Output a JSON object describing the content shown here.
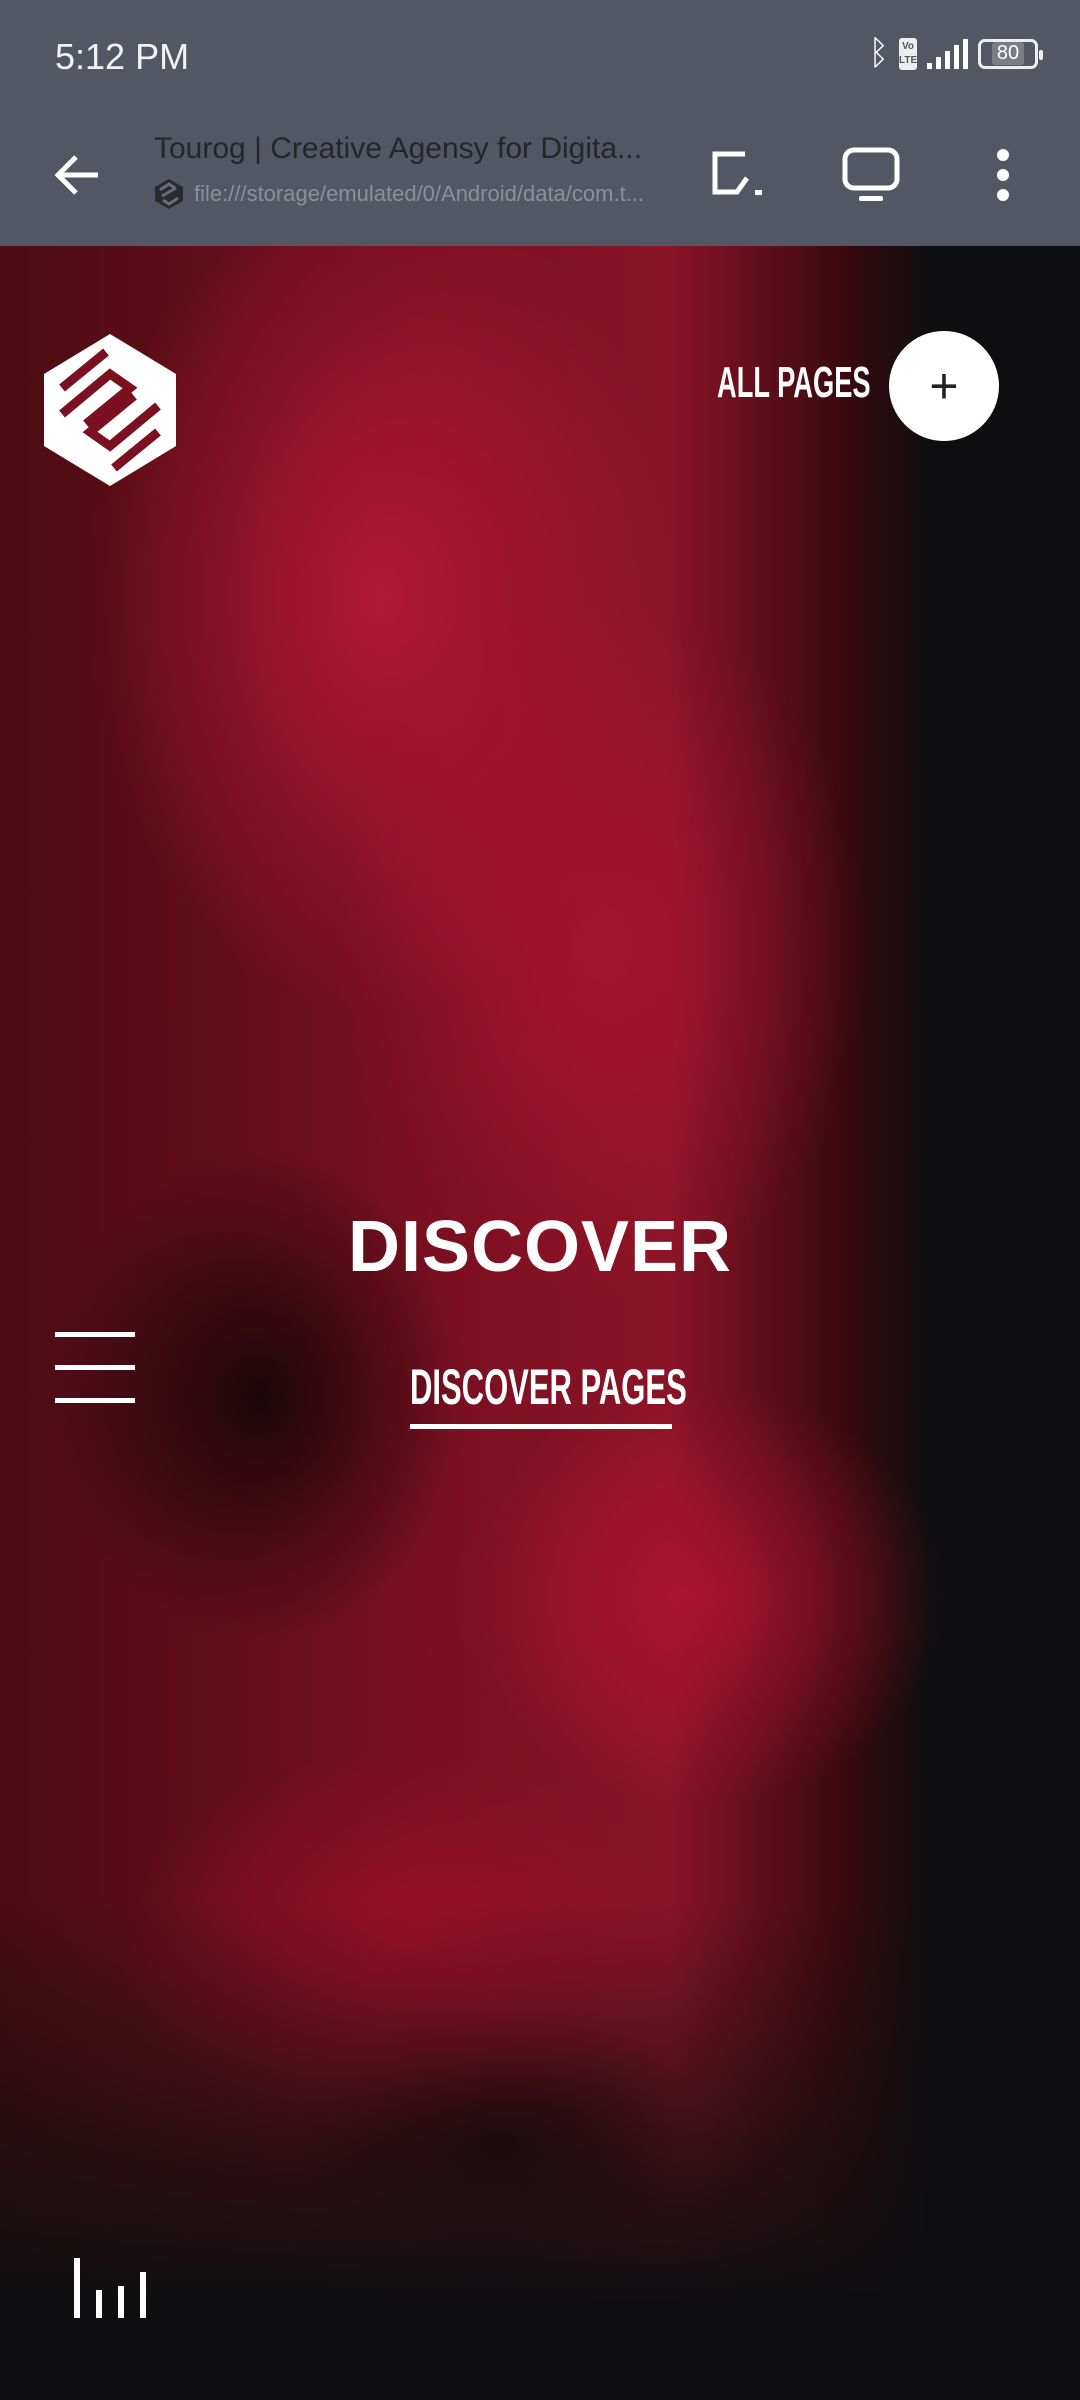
{
  "status_bar": {
    "time": "5:12 PM",
    "battery": "80",
    "icons": [
      "bluetooth-icon",
      "volte-icon",
      "signal-icon",
      "battery-icon"
    ]
  },
  "browser": {
    "title": "Tourog | Creative Agensy for Digita...",
    "url": "file:///storage/emulated/0/Android/data/com.t...",
    "icons": [
      "back-arrow-icon",
      "share-screen-icon",
      "desktop-icon",
      "more-vert-icon"
    ]
  },
  "page": {
    "all_pages": "ALL PAGES",
    "heading": "DISCOVER",
    "link": "DISCOVER PAGES",
    "colors": {
      "accent": "#8a1426",
      "background": "#0e0e10",
      "toolbar": "#535763"
    }
  }
}
